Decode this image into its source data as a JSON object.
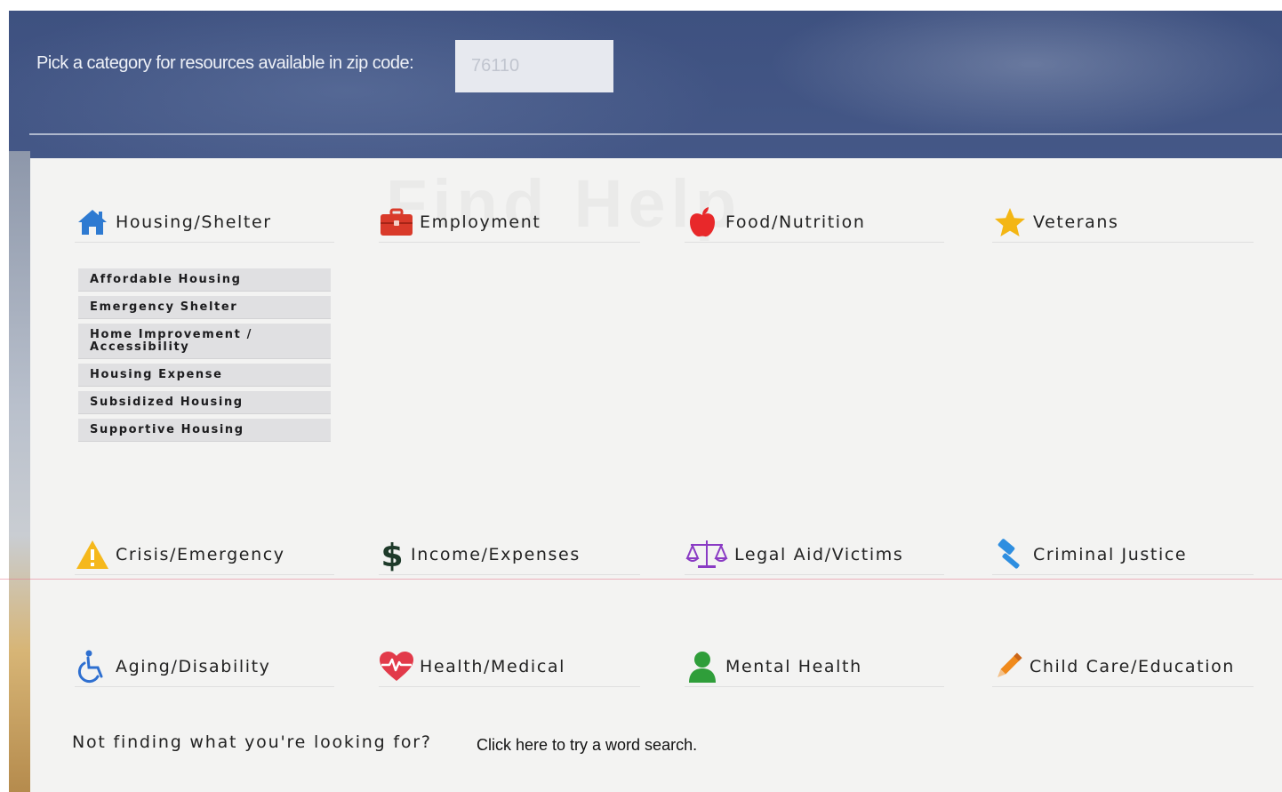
{
  "header": {
    "zip_label": "Pick a category for resources available in zip code:",
    "zip_value": "76110"
  },
  "panel": {
    "watermark": "Find Help"
  },
  "categories": [
    {
      "label": "Housing/Shelter",
      "icon": "house-icon",
      "color": "#2e7ad1"
    },
    {
      "label": "Employment",
      "icon": "briefcase-icon",
      "color": "#d93a2a"
    },
    {
      "label": "Food/Nutrition",
      "icon": "apple-icon",
      "color": "#e8282a"
    },
    {
      "label": "Veterans",
      "icon": "star-icon",
      "color": "#f3b614"
    },
    {
      "label": "Crisis/Emergency",
      "icon": "warning-icon",
      "color": "#f5b81c"
    },
    {
      "label": "Income/Expenses",
      "icon": "dollar-icon",
      "color": "#1e3a2a"
    },
    {
      "label": "Legal Aid/Victims",
      "icon": "scales-icon",
      "color": "#8a3bc4"
    },
    {
      "label": "Criminal Justice",
      "icon": "gavel-icon",
      "color": "#2e8ee0"
    },
    {
      "label": "Aging/Disability",
      "icon": "wheelchair-icon",
      "color": "#2e6fd0"
    },
    {
      "label": "Health/Medical",
      "icon": "heart-pulse-icon",
      "color": "#e23a4a"
    },
    {
      "label": "Mental Health",
      "icon": "person-icon",
      "color": "#2f9e3a"
    },
    {
      "label": "Child Care/Education",
      "icon": "pencil-icon",
      "color": "#f08a1c"
    }
  ],
  "housing_submenu": [
    "Affordable Housing",
    "Emergency Shelter",
    "Home Improvement / Accessibility",
    "Housing Expense",
    "Subsidized Housing",
    "Supportive Housing"
  ],
  "footer": {
    "prompt": "Not finding what you're looking for?",
    "link": "Click here to try a word search."
  }
}
